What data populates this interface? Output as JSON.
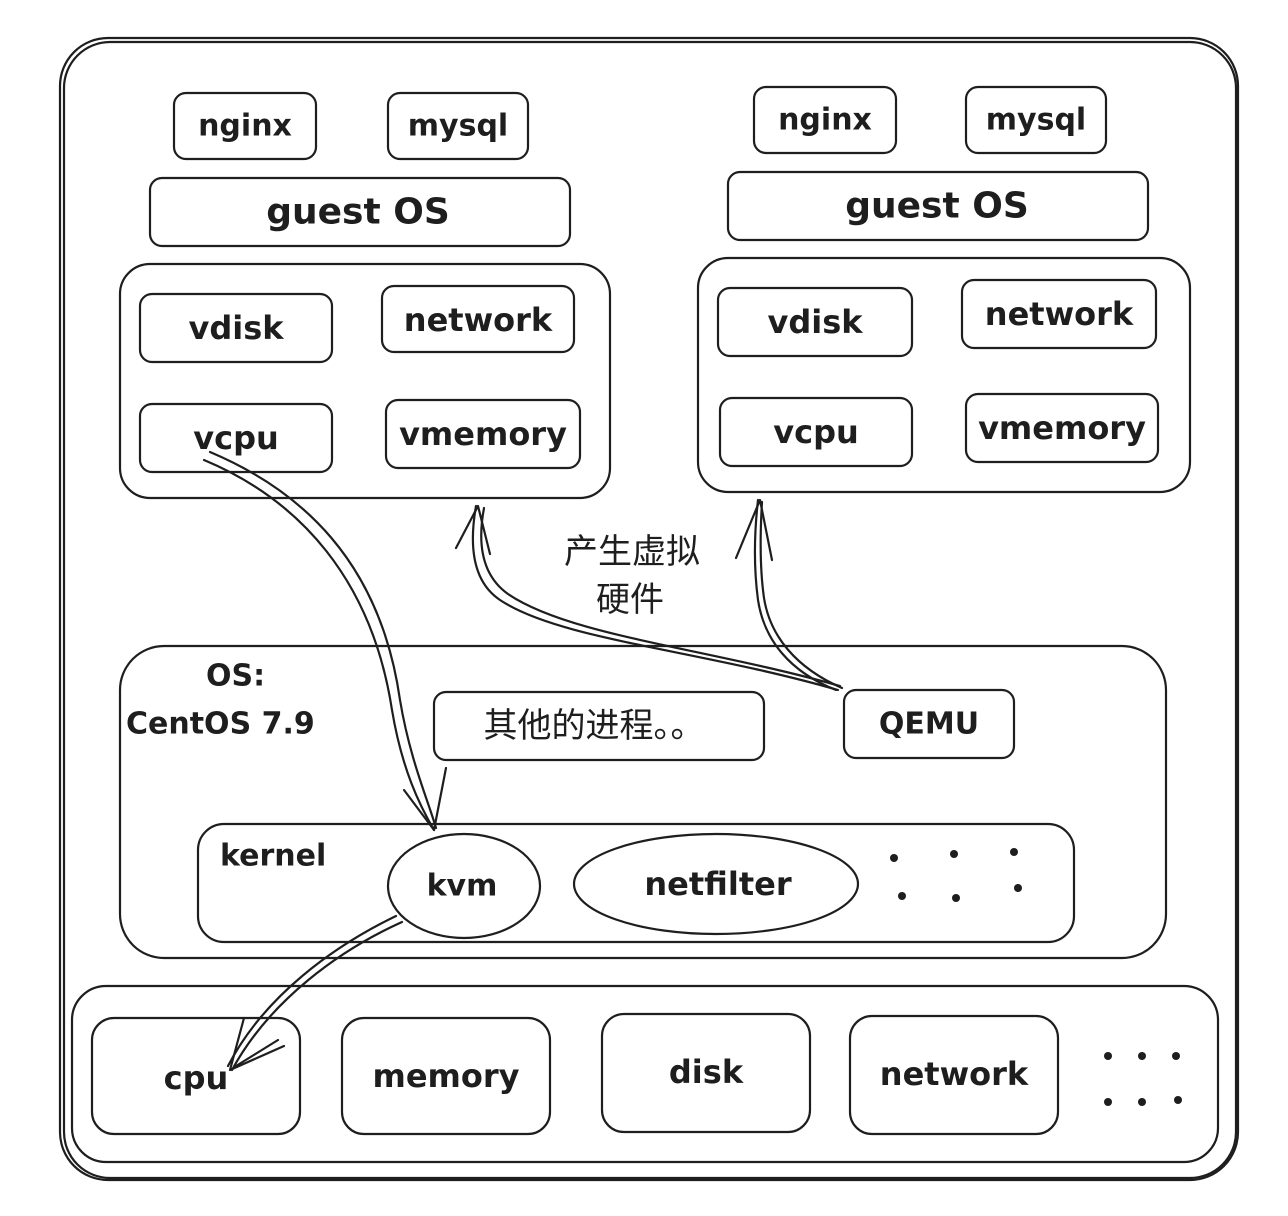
{
  "colors": {
    "stroke": "#1e1e1e",
    "yellow": "#f2d54a",
    "green": "#8fd6a0",
    "red": "#e8707a",
    "purple": "#a99be0",
    "teal": "#7fdcc6",
    "blue": "#7ab0e6",
    "pink": "#f0a8b0"
  },
  "vm_left": {
    "apps": [
      "nginx",
      "mysql"
    ],
    "guest_os": "guest OS",
    "hardware": [
      "vdisk",
      "network",
      "vcpu",
      "vmemory"
    ]
  },
  "vm_right": {
    "apps": [
      "nginx",
      "mysql"
    ],
    "guest_os": "guest OS",
    "hardware": [
      "vdisk",
      "network",
      "vcpu",
      "vmemory"
    ]
  },
  "annotation": {
    "line1": "产生虚拟",
    "line2": "硬件"
  },
  "host_os": {
    "label_line1": "OS:",
    "label_line2": "CentOS 7.9",
    "other_processes": "其他的进程。。",
    "qemu": "QEMU",
    "kernel": {
      "label": "kernel",
      "modules": [
        "kvm",
        "netfilter"
      ]
    }
  },
  "physical_hardware": [
    "cpu",
    "memory",
    "disk",
    "network"
  ]
}
